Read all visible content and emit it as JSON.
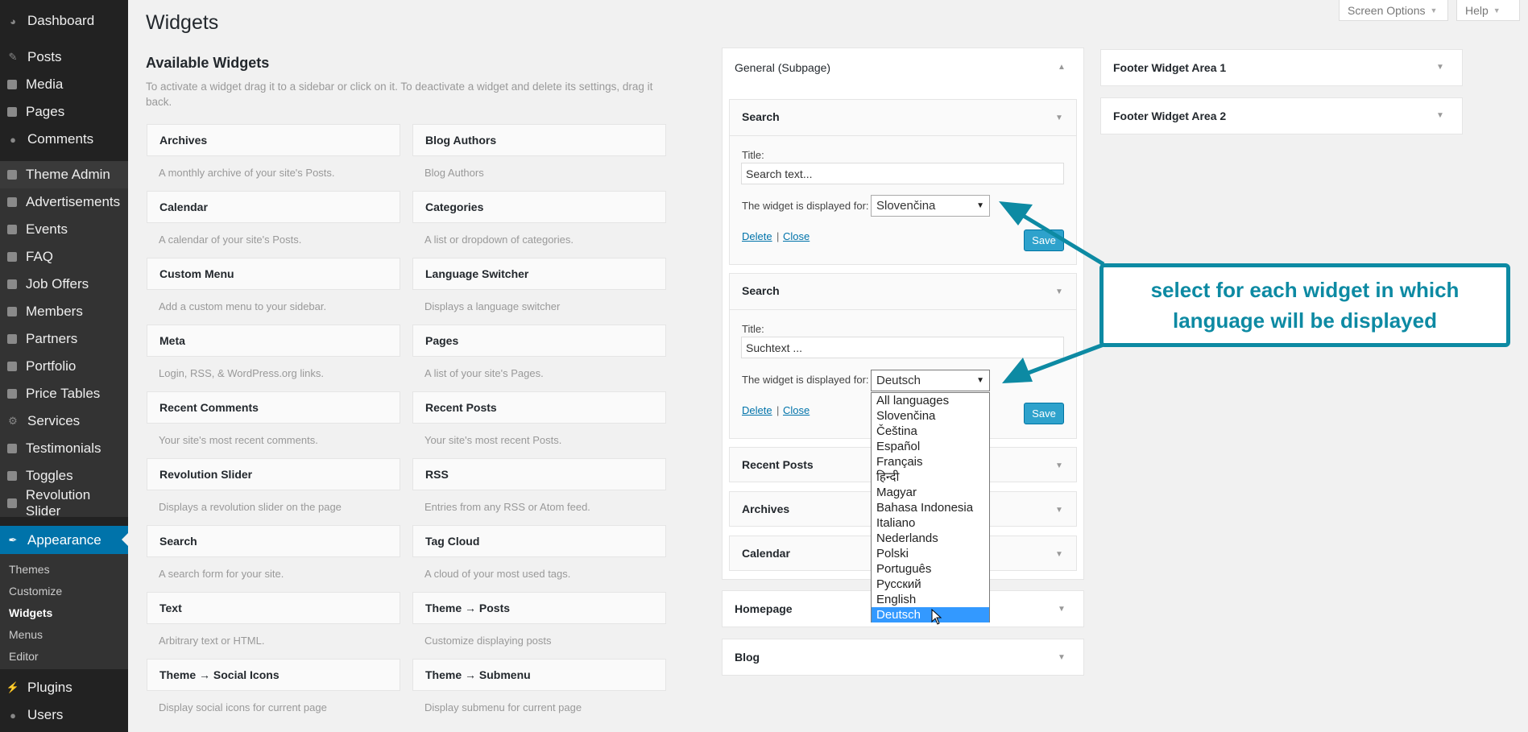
{
  "sidebar": {
    "dashboard": "Dashboard",
    "posts": "Posts",
    "media": "Media",
    "pages": "Pages",
    "comments": "Comments",
    "theme_admin": "Theme Admin",
    "advertisements": "Advertisements",
    "events": "Events",
    "faq": "FAQ",
    "job_offers": "Job Offers",
    "members": "Members",
    "partners": "Partners",
    "portfolio": "Portfolio",
    "price_tables": "Price Tables",
    "services": "Services",
    "testimonials": "Testimonials",
    "toggles": "Toggles",
    "revolution_slider": "Revolution Slider",
    "appearance": "Appearance",
    "plugins": "Plugins",
    "users": "Users",
    "submenu": {
      "themes": "Themes",
      "customize": "Customize",
      "widgets": "Widgets",
      "menus": "Menus",
      "editor": "Editor"
    }
  },
  "header": {
    "title": "Widgets",
    "screen_options": "Screen Options",
    "help": "Help"
  },
  "available": {
    "title": "Available Widgets",
    "description": "To activate a widget drag it to a sidebar or click on it. To deactivate a widget and delete its settings, drag it back.",
    "widgets": [
      {
        "name": "Archives",
        "desc": "A monthly archive of your site's Posts."
      },
      {
        "name": "Blog Authors",
        "desc": "Blog Authors"
      },
      {
        "name": "Calendar",
        "desc": "A calendar of your site's Posts."
      },
      {
        "name": "Categories",
        "desc": "A list or dropdown of categories."
      },
      {
        "name": "Custom Menu",
        "desc": "Add a custom menu to your sidebar."
      },
      {
        "name": "Language Switcher",
        "desc": "Displays a language switcher"
      },
      {
        "name": "Meta",
        "desc": "Login, RSS, & WordPress.org links."
      },
      {
        "name": "Pages",
        "desc": "A list of your site's Pages."
      },
      {
        "name": "Recent Comments",
        "desc": "Your site's most recent comments."
      },
      {
        "name": "Recent Posts",
        "desc": "Your site's most recent Posts."
      },
      {
        "name": "Revolution Slider",
        "desc": "Displays a revolution slider on the page"
      },
      {
        "name": "RSS",
        "desc": "Entries from any RSS or Atom feed."
      },
      {
        "name": "Search",
        "desc": "A search form for your site."
      },
      {
        "name": "Tag Cloud",
        "desc": "A cloud of your most used tags."
      },
      {
        "name": "Text",
        "desc": "Arbitrary text or HTML."
      },
      {
        "name": "Theme → Posts",
        "desc": "Customize displaying posts"
      },
      {
        "name": "Theme → Social Icons",
        "desc": "Display social icons for current page"
      },
      {
        "name": "Theme → Submenu",
        "desc": "Display submenu for current page"
      }
    ]
  },
  "general": {
    "title": "General (Subpage)",
    "search1": {
      "header": "Search",
      "title_label": "Title:",
      "title_value": "Search text...",
      "display_label": "The widget is displayed for:",
      "display_value": "Slovenčina",
      "delete": "Delete",
      "separator": "|",
      "close": "Close",
      "save": "Save"
    },
    "search2": {
      "header": "Search",
      "title_label": "Title:",
      "title_value": "Suchtext ...",
      "display_label": "The widget is displayed for:",
      "display_value": "Deutsch",
      "delete": "Delete",
      "separator": "|",
      "close": "Close",
      "save": "Save"
    },
    "recent_posts": "Recent Posts",
    "archives": "Archives",
    "calendar": "Calendar"
  },
  "homepage": "Homepage",
  "blog": "Blog",
  "footer1": "Footer Widget Area 1",
  "footer2": "Footer Widget Area 2",
  "languages": [
    "All languages",
    "Slovenčina",
    "Čeština",
    "Español",
    "Français",
    "हिन्दी",
    "Magyar",
    "Bahasa Indonesia",
    "Italiano",
    "Nederlands",
    "Polski",
    "Português",
    "Русский",
    "English",
    "Deutsch"
  ],
  "callout": "select for each widget in which language will be displayed",
  "colors": {
    "accent": "#0073aa",
    "callout": "#0d8aa3",
    "selection": "#3399ff"
  }
}
